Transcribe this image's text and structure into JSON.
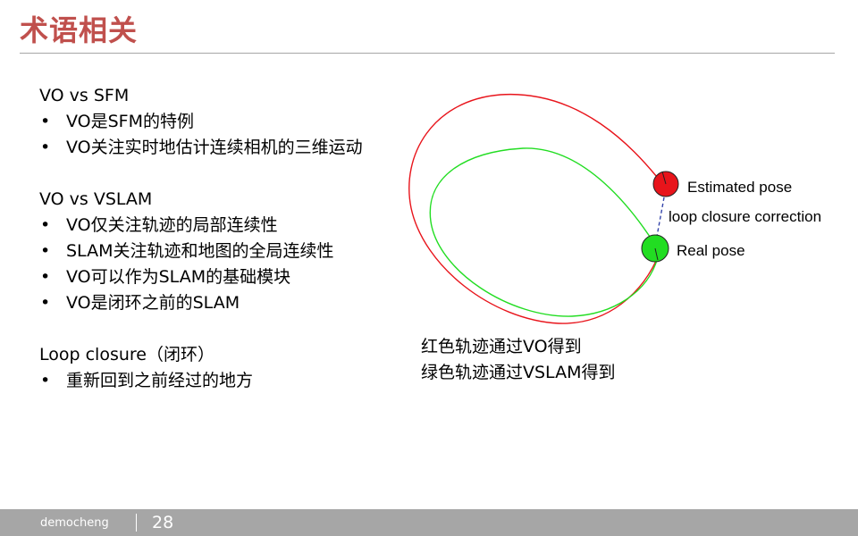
{
  "slide": {
    "title": "术语相关",
    "title_color": "#c0504d"
  },
  "sections": [
    {
      "heading": "VO vs SFM",
      "bullets": [
        "VO是SFM的特例",
        "VO关注实时地估计连续相机的三维运动"
      ]
    },
    {
      "heading": "VO vs VSLAM",
      "bullets": [
        "VO仅关注轨迹的局部连续性",
        "SLAM关注轨迹和地图的全局连续性",
        "VO可以作为SLAM的基础模块",
        "VO是闭环之前的SLAM"
      ]
    },
    {
      "heading": "Loop closure（闭环）",
      "bullets": [
        "重新回到之前经过的地方"
      ]
    }
  ],
  "bullet_symbol": "•",
  "diagram": {
    "estimated_pose_label": "Estimated pose",
    "correction_label": "loop closure correction",
    "real_pose_label": "Real pose",
    "vo_trajectory_color": "#e8141b",
    "vslam_trajectory_color": "#22dd22",
    "estimated_pose_color": "#e8141b",
    "real_pose_color": "#22dd22",
    "correction_color": "#3344aa"
  },
  "caption": {
    "line1": "红色轨迹通过VO得到",
    "line2": "绿色轨迹通过VSLAM得到"
  },
  "footer": {
    "author": "democheng",
    "page_number": "28",
    "bar_color": "#a6a6a6"
  }
}
